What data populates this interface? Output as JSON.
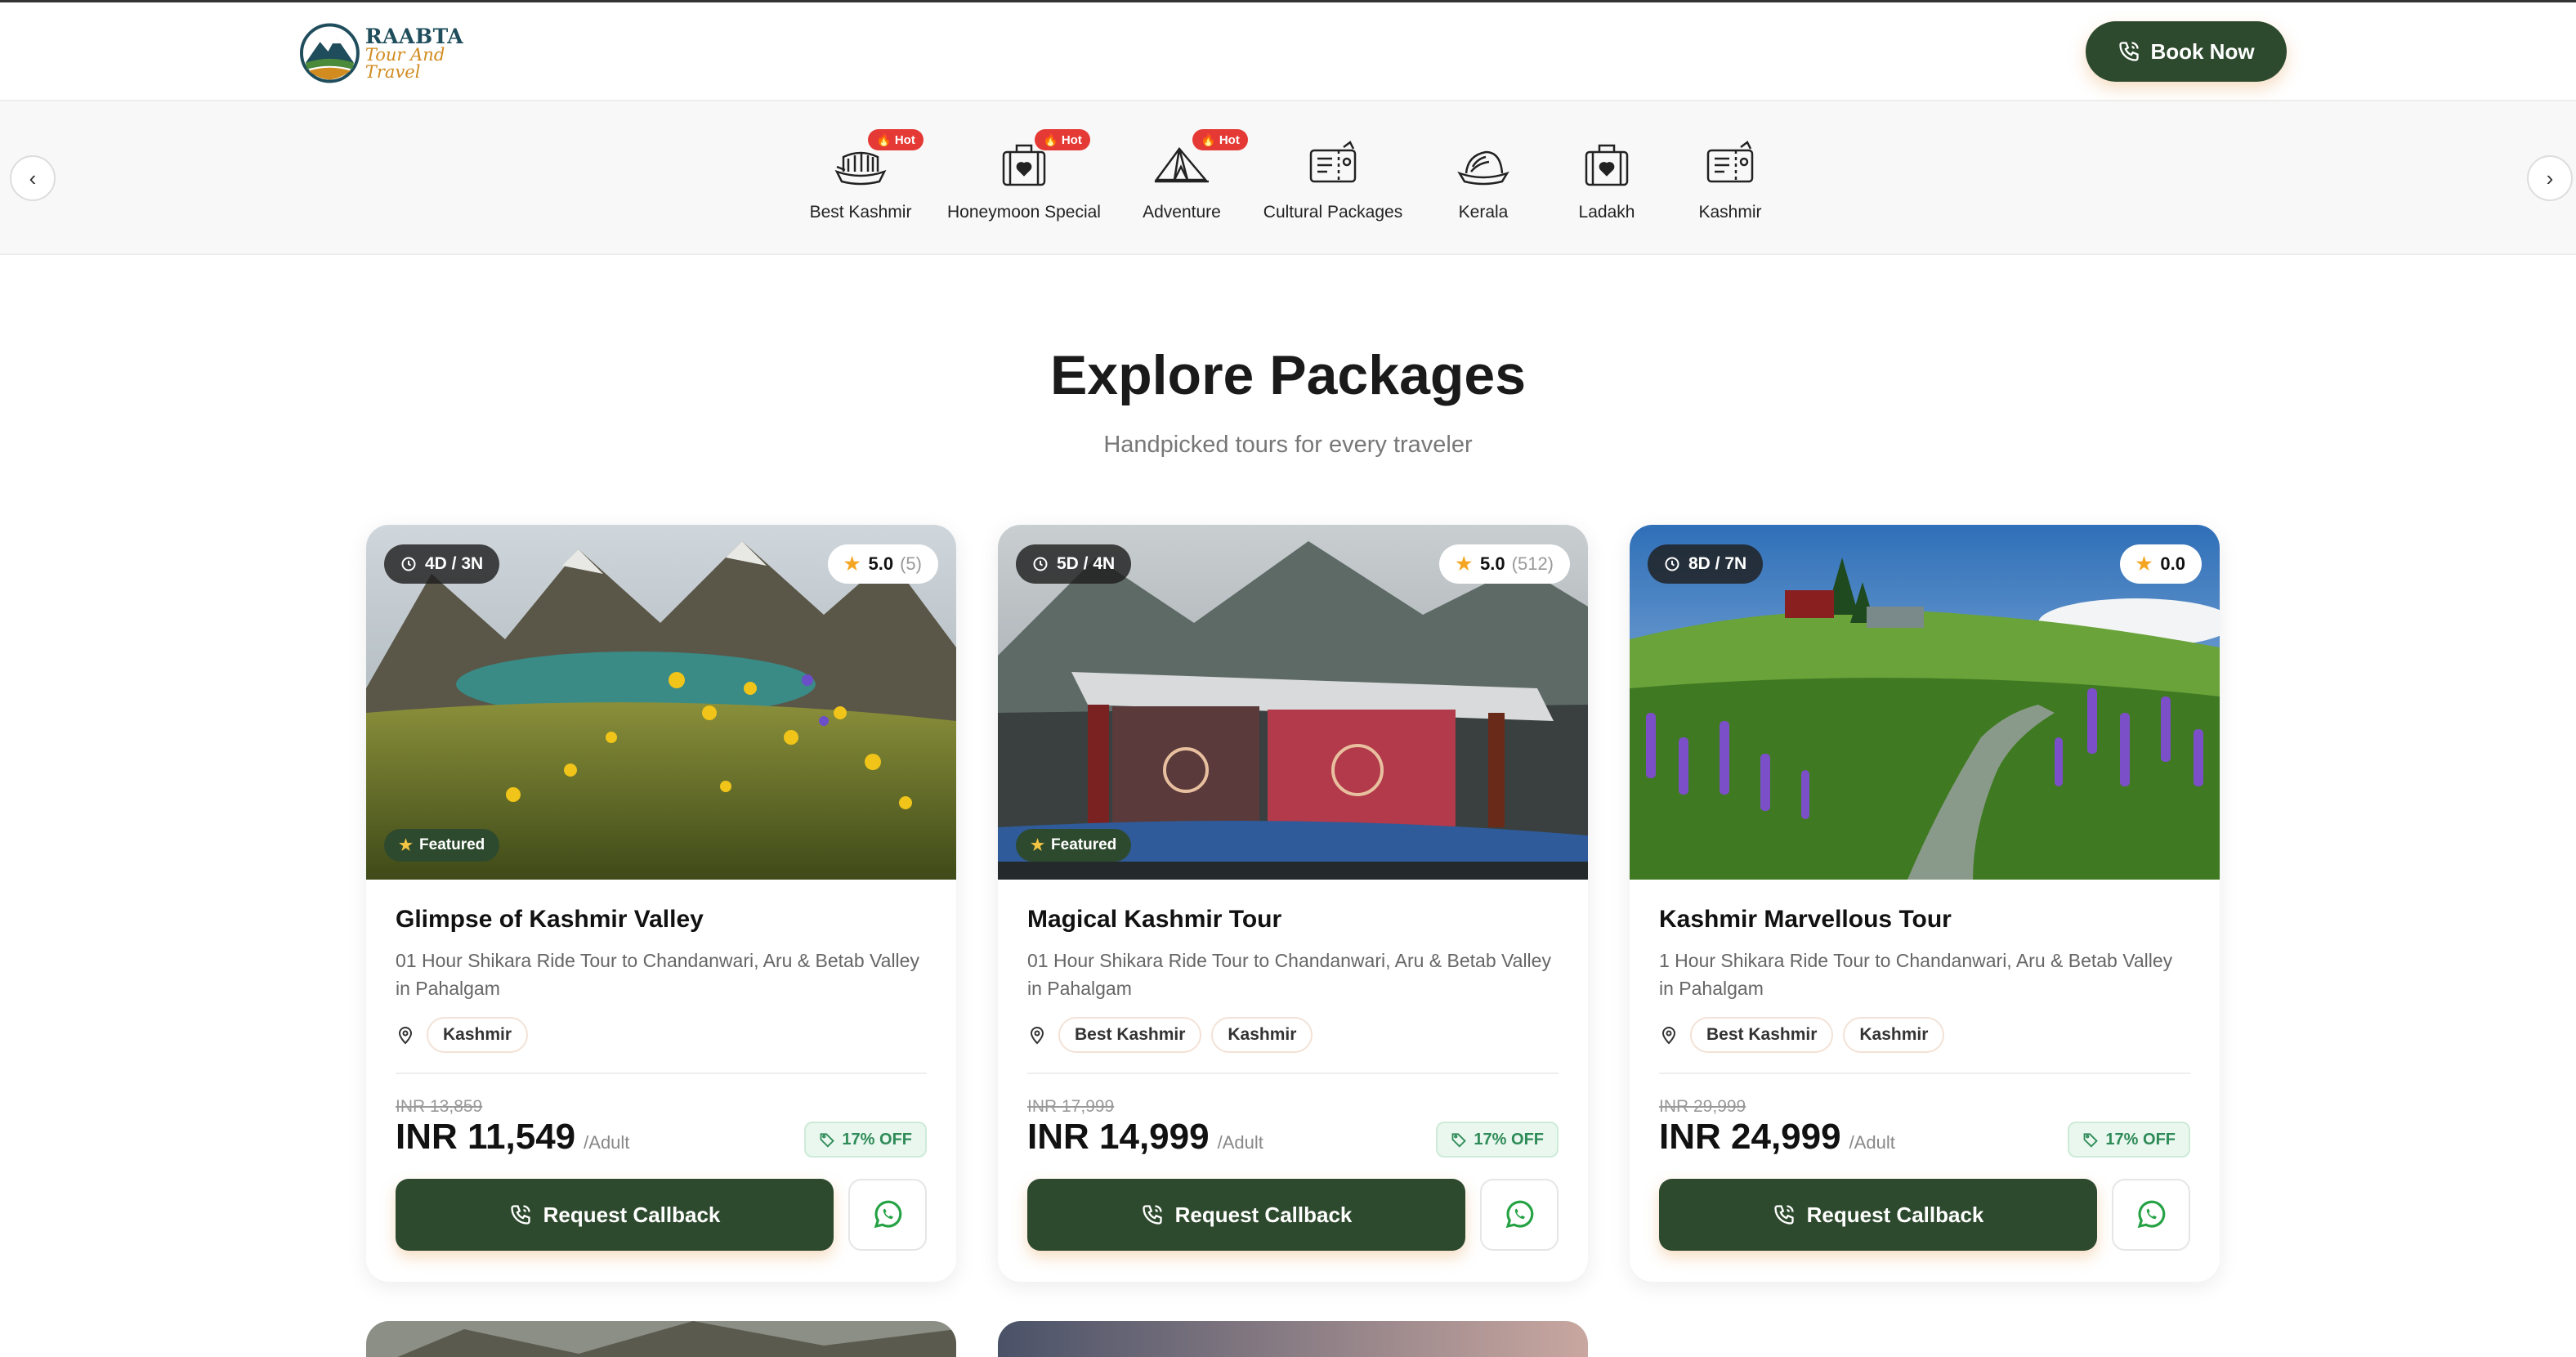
{
  "brand": {
    "name": "RAABTA",
    "tagline": "Tour And Travel",
    "primary_color": "#2e4a2e",
    "accent_color": "#d18b1f"
  },
  "header": {
    "book_now_label": "Book Now",
    "book_now_icon": "phone-icon"
  },
  "categories": {
    "prev_label": "‹",
    "next_label": "›",
    "hot_label": "🔥 Hot",
    "items": [
      {
        "label": "Best Kashmir",
        "icon": "shikara-boat-icon",
        "hot": true
      },
      {
        "label": "Honeymoon Special",
        "icon": "suitcase-heart-icon",
        "hot": true
      },
      {
        "label": "Adventure",
        "icon": "tent-icon",
        "hot": true
      },
      {
        "label": "Cultural Packages",
        "icon": "ticket-icon",
        "hot": false
      },
      {
        "label": "Kerala",
        "icon": "houseboat-icon",
        "hot": false
      },
      {
        "label": "Ladakh",
        "icon": "suitcase-heart-icon",
        "hot": false
      },
      {
        "label": "Kashmir",
        "icon": "ticket-icon",
        "hot": false
      }
    ]
  },
  "section": {
    "title": "Explore Packages",
    "subtitle": "Handpicked tours for every traveler"
  },
  "packages": [
    {
      "duration": "4D / 3N",
      "rating": "5.0",
      "rating_count": "(5)",
      "featured": "Featured",
      "title": "Glimpse of Kashmir Valley",
      "description": "01 Hour Shikara Ride Tour to Chandanwari, Aru & Betab Valley in Pahalgam",
      "tags": [
        "Kashmir"
      ],
      "old_price": "INR 13,859",
      "price": "INR 11,549",
      "per": "/Adult",
      "discount": "17% OFF",
      "cta": "Request Callback"
    },
    {
      "duration": "5D / 4N",
      "rating": "5.0",
      "rating_count": "(512)",
      "featured": "Featured",
      "title": "Magical Kashmir Tour",
      "description": "01 Hour Shikara Ride Tour to Chandanwari, Aru & Betab Valley in Pahalgam",
      "tags": [
        "Best Kashmir",
        "Kashmir"
      ],
      "old_price": "INR 17,999",
      "price": "INR 14,999",
      "per": "/Adult",
      "discount": "17% OFF",
      "cta": "Request Callback"
    },
    {
      "duration": "8D / 7N",
      "rating": "0.0",
      "rating_count": "",
      "featured": "",
      "title": "Kashmir Marvellous Tour",
      "description": "1 Hour Shikara Ride Tour to Chandanwari, Aru & Betab Valley in Pahalgam",
      "tags": [
        "Best Kashmir",
        "Kashmir"
      ],
      "old_price": "INR 29,999",
      "price": "INR 24,999",
      "per": "/Adult",
      "discount": "17% OFF",
      "cta": "Request Callback"
    }
  ]
}
